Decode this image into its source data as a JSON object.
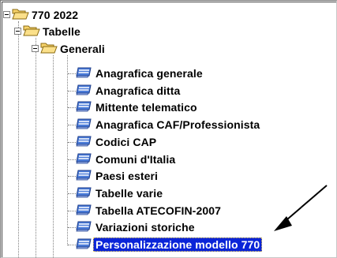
{
  "tree": {
    "root": {
      "label": "770 2022",
      "icon": "folder-open-icon"
    },
    "level1": {
      "label": "Tabelle",
      "icon": "folder-open-icon"
    },
    "level2": {
      "label": "Generali",
      "icon": "folder-open-icon"
    },
    "items": [
      {
        "label": "Anagrafica generale",
        "icon": "table-icon"
      },
      {
        "label": "Anagrafica ditta",
        "icon": "table-icon"
      },
      {
        "label": "Mittente telematico",
        "icon": "table-icon"
      },
      {
        "label": "Anagrafica CAF/Professionista",
        "icon": "table-icon"
      },
      {
        "label": "Codici CAP",
        "icon": "table-icon"
      },
      {
        "label": "Comuni d'Italia",
        "icon": "table-icon"
      },
      {
        "label": "Paesi esteri",
        "icon": "table-icon"
      },
      {
        "label": "Tabelle varie",
        "icon": "table-icon"
      },
      {
        "label": "Tabella ATECOFIN-2007",
        "icon": "table-icon"
      },
      {
        "label": "Variazioni storiche",
        "icon": "table-icon"
      },
      {
        "label": "Personalizzazione modello 770",
        "icon": "table-icon",
        "selected": true
      }
    ]
  },
  "colors": {
    "selection": "#0a24d8",
    "folder": "#f7d36b",
    "table_icon": "#4a7bd8"
  },
  "annotation": {
    "icon": "arrow-pointer-icon"
  }
}
